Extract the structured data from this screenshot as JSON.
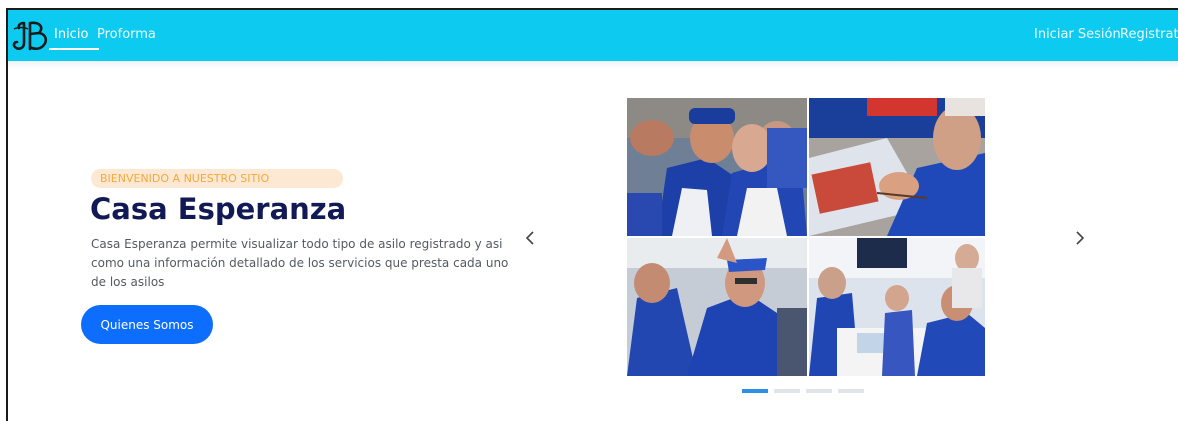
{
  "navbar": {
    "logo_icon": "jb-monogram-logo",
    "links": [
      {
        "label": "Inicio",
        "active": true
      },
      {
        "label": "Proforma",
        "active": false
      }
    ],
    "auth": {
      "login_label": "Iniciar Sesión",
      "register_label": "Registrate"
    },
    "background_color": "#0dcaf0"
  },
  "hero": {
    "badge": "BIENVENIDO A NUESTRO SITIO",
    "title": "Casa Esperanza",
    "description": "Casa Esperanza permite visualizar todo tipo de asilo registrado y asi como una información detallado de los servicios que presta cada uno de los asilos",
    "button_label": "Quienes Somos",
    "title_color": "#121a56",
    "badge_color": "#f3a93a",
    "button_color": "#0d6efd"
  },
  "carousel": {
    "prev_icon": "chevron-left-icon",
    "next_icon": "chevron-right-icon",
    "slide_count": 4,
    "active_slide": 0
  }
}
